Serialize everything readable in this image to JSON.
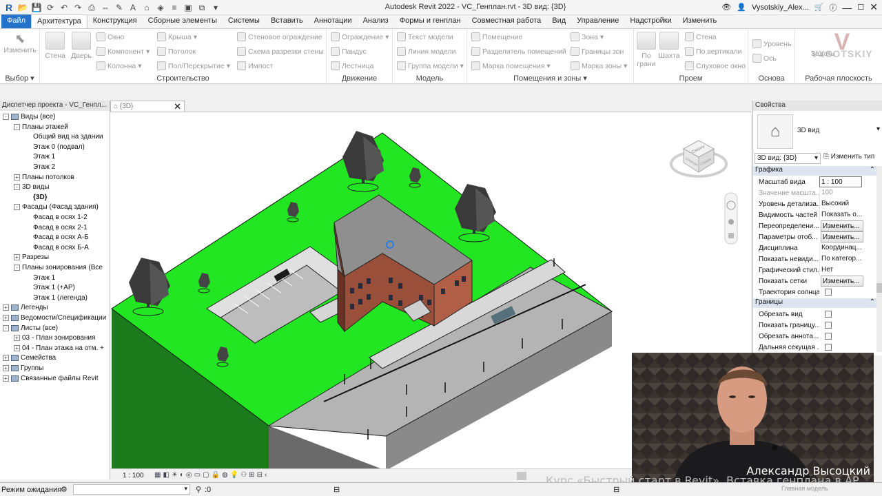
{
  "window": {
    "title": "Autodesk Revit 2022 - VC_Генплан.rvt - 3D вид: {3D}",
    "user": "Vysotskiy_Alex..."
  },
  "tabs": [
    "Файл",
    "Архитектура",
    "Конструкция",
    "Сборные элементы",
    "Системы",
    "Вставить",
    "Аннотации",
    "Анализ",
    "Формы и генплан",
    "Совместная работа",
    "Вид",
    "Управление",
    "Надстройки",
    "Изменить"
  ],
  "ribbon": {
    "select": {
      "modify": "Изменить",
      "title": "Выбор"
    },
    "build": {
      "wall": "Стена",
      "door": "Дверь",
      "window": "Окно",
      "component": "Компонент",
      "column": "Колонна",
      "roof": "Крыша",
      "ceiling": "Потолок",
      "floor": "Пол/Перекрытие",
      "curtain_system": "Стеновое ограждение",
      "curtain_grid": "Схема разрезки стены",
      "mullion": "Импост",
      "title": "Строительство"
    },
    "circulation": {
      "railing": "Ограждение",
      "ramp": "Пандус",
      "stair": "Лестница",
      "title": "Движение"
    },
    "model": {
      "model_text": "Текст модели",
      "model_line": "Линия модели",
      "model_group": "Группа модели",
      "title": "Модель"
    },
    "rooms": {
      "room": "Помещение",
      "room_separator": "Разделитель помещений",
      "tag_room": "Марка помещения",
      "area": "Зона",
      "area_boundary": "Границы зон",
      "tag_area": "Марка зоны",
      "title": "Помещения и зоны"
    },
    "opening": {
      "by_face": "По грани",
      "shaft": "Шахта",
      "wall": "Стена",
      "vertical": "По вертикали",
      "dormer": "Слуховое окно",
      "title": "Проем"
    },
    "datum": {
      "level": "Уровень",
      "grid": "Ось",
      "title": "Основа"
    },
    "workplane": {
      "set": "Задать",
      "title": "Рабочая плоскость"
    },
    "watermark": "VYSOTSKIY"
  },
  "browser": {
    "title": "Диспетчер проекта - VC_Генпл...",
    "items": [
      {
        "label": "Виды (все)",
        "level": 0,
        "toggle": "-"
      },
      {
        "label": "Планы этажей",
        "level": 1,
        "toggle": "-"
      },
      {
        "label": "Общий вид на здании",
        "level": 2
      },
      {
        "label": "Этаж 0 (подвал)",
        "level": 2
      },
      {
        "label": "Этаж 1",
        "level": 2
      },
      {
        "label": "Этаж 2",
        "level": 2
      },
      {
        "label": "Планы потолков",
        "level": 1,
        "toggle": "+"
      },
      {
        "label": "3D виды",
        "level": 1,
        "toggle": "-"
      },
      {
        "label": "{3D}",
        "level": 2,
        "bold": true
      },
      {
        "label": "Фасады (Фасад здания)",
        "level": 1,
        "toggle": "-"
      },
      {
        "label": "Фасад в осях 1-2",
        "level": 2
      },
      {
        "label": "Фасад в осях 2-1",
        "level": 2
      },
      {
        "label": "Фасад в осях А-Б",
        "level": 2
      },
      {
        "label": "Фасад в осях Б-А",
        "level": 2
      },
      {
        "label": "Разрезы",
        "level": 1,
        "toggle": "+"
      },
      {
        "label": "Планы зонирования (Все",
        "level": 1,
        "toggle": "-"
      },
      {
        "label": "Этаж 1",
        "level": 2
      },
      {
        "label": "Этаж 1 (+АР)",
        "level": 2
      },
      {
        "label": "Этаж 1 (легенда)",
        "level": 2
      },
      {
        "label": "Легенды",
        "level": 0,
        "toggle": "+"
      },
      {
        "label": "Ведомости/Спецификации",
        "level": 0,
        "toggle": "+"
      },
      {
        "label": "Листы (все)",
        "level": 0,
        "toggle": "-"
      },
      {
        "label": "03 - План зонирования",
        "level": 1,
        "toggle": "+"
      },
      {
        "label": "04 - План этажа на отм. +",
        "level": 1,
        "toggle": "+"
      },
      {
        "label": "Семейства",
        "level": 0,
        "toggle": "+"
      },
      {
        "label": "Группы",
        "level": 0,
        "toggle": "+"
      },
      {
        "label": "Связанные файлы Revit",
        "level": 0,
        "toggle": "+"
      }
    ]
  },
  "viewport": {
    "tab": "{3D}",
    "scale": "1 : 100",
    "viewcube_top": "Сверху",
    "viewcube_front": "Спереди",
    "viewcube_right": "Справа"
  },
  "properties": {
    "title": "Свойства",
    "type_name": "3D вид",
    "selector": "3D вид: {3D}",
    "edit_type": "Изменить тип",
    "sec_graphics": "Графика",
    "sec_extents": "Границы",
    "rows": [
      {
        "key": "Масштаб вида",
        "val": "1 : 100"
      },
      {
        "key": "Значение масшта...",
        "val": "100"
      },
      {
        "key": "Уровень детализа...",
        "val": "Высокий"
      },
      {
        "key": "Видимость частей",
        "val": "Показать о..."
      },
      {
        "key": "Переопределени...",
        "val": "Изменить..."
      },
      {
        "key": "Параметры отоб...",
        "val": "Изменить..."
      },
      {
        "key": "Дисциплина",
        "val": "Координац..."
      },
      {
        "key": "Показать невиди...",
        "val": "По категор..."
      },
      {
        "key": "Графический стил...",
        "val": "Нет"
      },
      {
        "key": "Показать сетки",
        "val": "Изменить..."
      },
      {
        "key": "Траектория солнца",
        "val": ""
      }
    ],
    "rows2": [
      {
        "key": "Обрезать вид"
      },
      {
        "key": "Показать границу..."
      },
      {
        "key": "Обрезать аннота..."
      },
      {
        "key": "Дальняя секущая ..."
      }
    ]
  },
  "status": {
    "left": "Режим ожидания",
    "count": ":0",
    "model": "Главная модель"
  },
  "webcam": {
    "name": "Александр Высоцкий"
  },
  "caption": "Курс «Быстрый старт в Revit». Вставка генплана в АР"
}
